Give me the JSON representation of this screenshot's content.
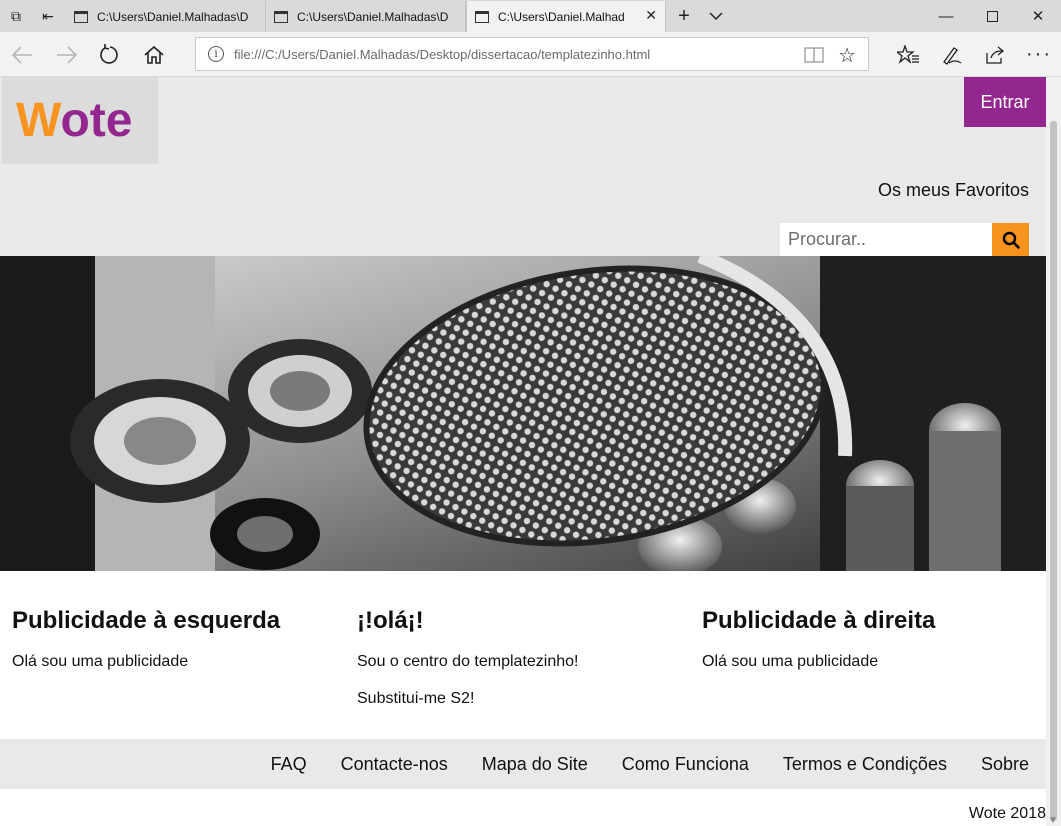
{
  "browser": {
    "tabs": [
      {
        "title": "C:\\Users\\Daniel.Malhadas\\D"
      },
      {
        "title": "C:\\Users\\Daniel.Malhadas\\D"
      },
      {
        "title": "C:\\Users\\Daniel.Malhad",
        "active": true
      }
    ],
    "url": "file:///C:/Users/Daniel.Malhadas/Desktop/dissertacao/templatezinho.html"
  },
  "header": {
    "logo_first": "W",
    "logo_rest": "ote",
    "login_label": "Entrar",
    "favorites_label": "Os meus Favoritos",
    "search_placeholder": "Procurar.."
  },
  "columns": [
    {
      "title": "Publicidade à esquerda",
      "lines": [
        "Olá sou uma publicidade"
      ]
    },
    {
      "title": "¡!olá¡!",
      "lines": [
        "Sou o centro do templatezinho!",
        "Substitui-me S2!"
      ]
    },
    {
      "title": "Publicidade à direita",
      "lines": [
        "Olá sou uma publicidade"
      ]
    }
  ],
  "footer": {
    "links": [
      "FAQ",
      "Contacte-nos",
      "Mapa do Site",
      "Como Funciona",
      "Termos e Condições",
      "Sobre"
    ],
    "copyright": "Wote 2018"
  },
  "colors": {
    "orange": "#f7931e",
    "purple": "#93278f",
    "header_bg": "#e9e9e9"
  }
}
